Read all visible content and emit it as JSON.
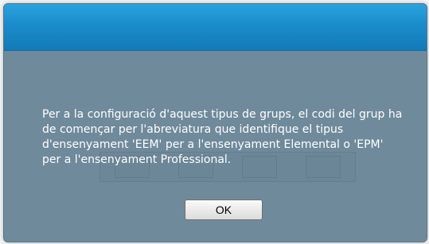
{
  "dialog": {
    "title": "",
    "message": "Per a la configuració d'aquest tipus de grups, el codi del grup ha de començar per l'abreviatura que identifique el tipus d'ensenyament 'EEM' per a l'ensenyament Elemental o 'EPM' per a l'ensenyament Professional.",
    "ok_label": "OK"
  },
  "colors": {
    "title_bar": "#1b8ccb",
    "body": "#6f8a9b",
    "text": "#ffffff"
  }
}
